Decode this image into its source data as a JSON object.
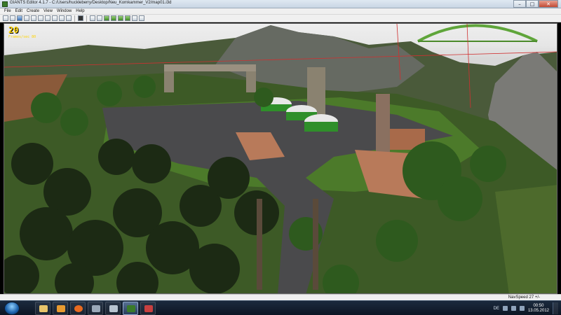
{
  "window": {
    "title": "GIANTS Editor 4.1.7 - C:/Users/huckleberry/Desktop/Neu_Kornkammer_V2/map01.i3d",
    "minimize": "–",
    "maximize": "□",
    "close": "✕"
  },
  "menu": [
    "File",
    "Edit",
    "Create",
    "View",
    "Window",
    "Help"
  ],
  "viewport": {
    "fps": "20",
    "fps_label": "Frames/sec 80"
  },
  "status": {
    "nav_speed": "NavSpeed 27 +/-"
  },
  "taskbar": {
    "language": "DE",
    "time": "00:50",
    "date": "13.05.2012"
  },
  "colors": {
    "terrain": "#3d5a26",
    "grass": "#4c7a2a",
    "road": "#4a4a4c",
    "sky": "#e6e6e6",
    "water": "#6f8796",
    "silo_green": "#2f8f2a",
    "grid_red": "#d03030",
    "fps_yellow": "#ffd400"
  }
}
